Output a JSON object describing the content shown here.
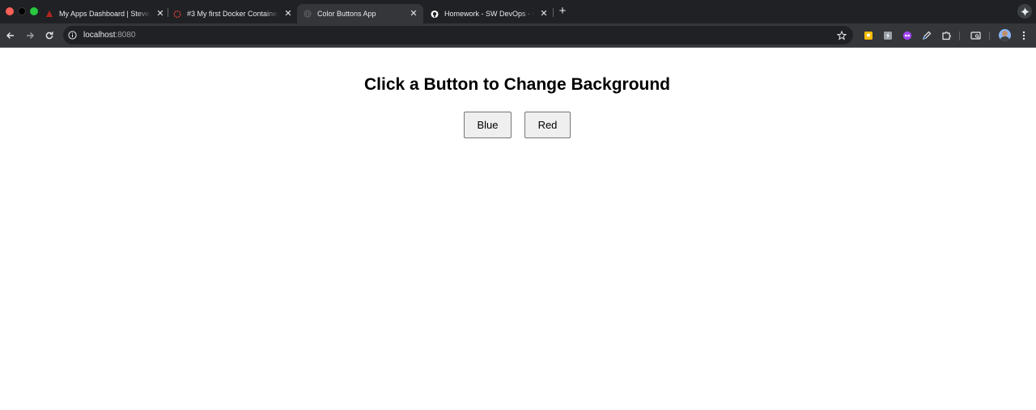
{
  "browser": {
    "tabs": [
      {
        "title": "My Apps Dashboard | Steven",
        "active": false
      },
      {
        "title": "#3 My first Docker Container",
        "active": false
      },
      {
        "title": "Color Buttons App",
        "active": true
      },
      {
        "title": "Homework - SW DevOps - Or",
        "active": false
      }
    ],
    "new_tab": "+",
    "address_bar": {
      "host": "localhost",
      "port": ":8080"
    },
    "colors": {
      "frame": "#202124",
      "toolbar": "#35363a",
      "omnibox": "#202124",
      "text": "#e8eaed"
    },
    "extension_icons": [
      "keep-icon",
      "bolt-icon",
      "purple-extension-icon",
      "pen-icon",
      "puzzle-icon",
      "tab-search-icon",
      "avatar",
      "menu-icon"
    ]
  },
  "page": {
    "heading": "Click a Button to Change Background",
    "buttons": {
      "blue": "Blue",
      "red": "Red"
    },
    "background": "#ffffff"
  }
}
